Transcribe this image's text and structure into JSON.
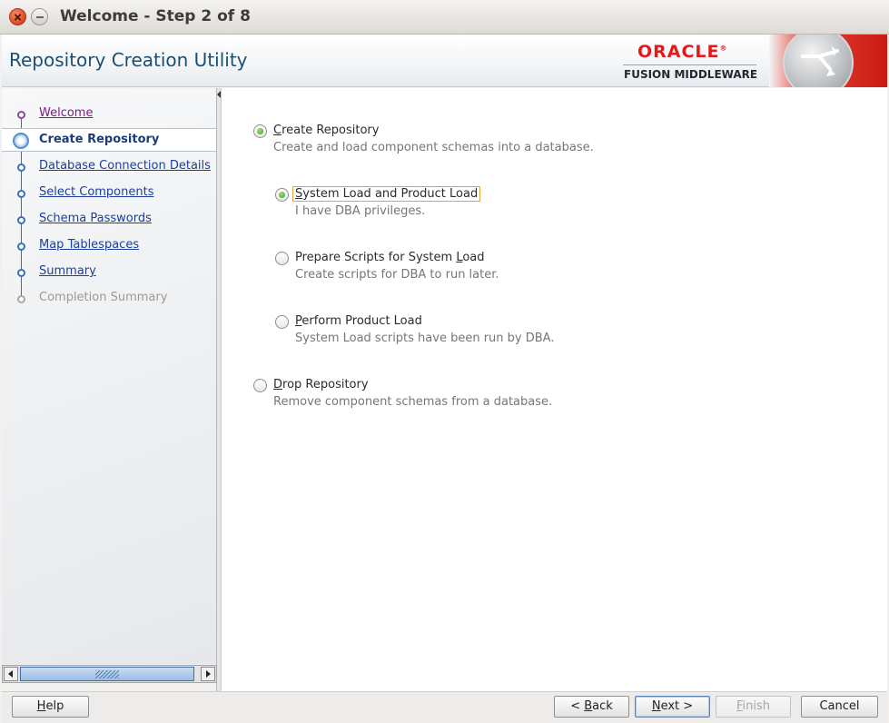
{
  "window": {
    "title": "Welcome - Step 2 of 8"
  },
  "header": {
    "app_title": "Repository Creation Utility",
    "brand_name": "ORACLE",
    "brand_mark": "®",
    "brand_subtitle": "FUSION MIDDLEWARE",
    "brand_color": "#e31a1c"
  },
  "sidebar": {
    "steps": [
      {
        "label": "Welcome",
        "state": "visited"
      },
      {
        "label": "Create Repository",
        "state": "current"
      },
      {
        "label": "Database Connection Details",
        "state": "link"
      },
      {
        "label": "Select Components",
        "state": "link"
      },
      {
        "label": "Schema Passwords",
        "state": "link"
      },
      {
        "label": "Map Tablespaces",
        "state": "link"
      },
      {
        "label": "Summary",
        "state": "link"
      },
      {
        "label": "Completion Summary",
        "state": "disabled"
      }
    ]
  },
  "main": {
    "options": {
      "create_repository": {
        "label_mnemonic": "C",
        "label_rest": "reate Repository",
        "description": "Create and load component schemas into a database.",
        "checked": true
      },
      "system_and_product_load": {
        "label_mnemonic": "S",
        "label_rest": "ystem Load and Product Load",
        "description": "I have DBA privileges.",
        "checked": true
      },
      "prepare_scripts": {
        "label_pre": "Prepare Scripts for System ",
        "label_mnemonic": "L",
        "label_rest": "oad",
        "description": "Create scripts for DBA to run later.",
        "checked": false
      },
      "perform_product_load": {
        "label_mnemonic": "P",
        "label_rest": "erform Product Load",
        "description": "System Load scripts have been run by DBA.",
        "checked": false
      },
      "drop_repository": {
        "label_mnemonic": "D",
        "label_rest": "rop Repository",
        "description": "Remove component schemas from a database.",
        "checked": false
      }
    }
  },
  "buttons": {
    "help": {
      "mnemonic": "H",
      "rest": "elp"
    },
    "back": {
      "pre": "< ",
      "mnemonic": "B",
      "rest": "ack"
    },
    "next": {
      "mnemonic": "N",
      "rest": "ext >"
    },
    "finish": {
      "mnemonic": "F",
      "rest": "inish"
    },
    "cancel": {
      "label": "Cancel"
    }
  }
}
